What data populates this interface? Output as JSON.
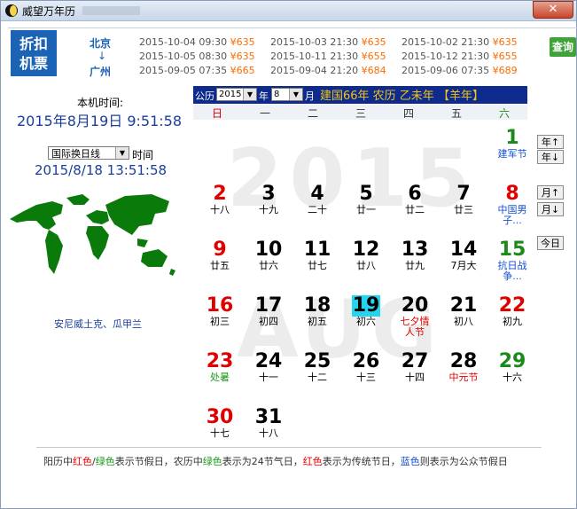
{
  "window": {
    "title": "威望万年历"
  },
  "banner": {
    "ticket_button": [
      "折扣",
      "机票"
    ],
    "from_city": "北京",
    "arrow": "↓",
    "to_city": "广州",
    "query_button": "查询",
    "fares": [
      [
        "2015-10-04 09:30",
        "¥635"
      ],
      [
        "2015-10-03 21:30",
        "¥635"
      ],
      [
        "2015-10-02 21:30",
        "¥635"
      ],
      [
        "2015-10-05 08:30",
        "¥635"
      ],
      [
        "2015-10-11 21:30",
        "¥655"
      ],
      [
        "2015-10-12 21:30",
        "¥655"
      ],
      [
        "2015-09-05 07:35",
        "¥665"
      ],
      [
        "2015-09-04 21:20",
        "¥684"
      ],
      [
        "2015-09-06 07:35",
        "¥689"
      ]
    ]
  },
  "left": {
    "local_time_label": "本机时间:",
    "local_time": "2015年8月19日  9:51:58",
    "tz_select": "国际换日线",
    "tz_time_label": "时间",
    "tz_datetime": "2015/8/18 13:51:58",
    "location": "安尼威土克、瓜甲兰"
  },
  "calendar": {
    "gregorian_label": "公历",
    "year_value": "2015",
    "year_label": "年",
    "month_value": "8",
    "month_label": "月",
    "lunar_header": "建国66年  农历  乙未年  【羊年】",
    "weekdays": [
      "日",
      "一",
      "二",
      "三",
      "四",
      "五",
      "六"
    ],
    "watermark_year": "2015",
    "watermark_month": "AUG",
    "days": [
      {
        "n": "1",
        "sub": "建军节",
        "nc": "#1a8a1a",
        "sc": "#1450d0"
      },
      {
        "n": "2",
        "sub": "十八",
        "nc": "#e00000",
        "sc": "#000"
      },
      {
        "n": "3",
        "sub": "十九",
        "nc": "#000",
        "sc": "#000"
      },
      {
        "n": "4",
        "sub": "二十",
        "nc": "#000",
        "sc": "#000"
      },
      {
        "n": "5",
        "sub": "廿一",
        "nc": "#000",
        "sc": "#000"
      },
      {
        "n": "6",
        "sub": "廿二",
        "nc": "#000",
        "sc": "#000"
      },
      {
        "n": "7",
        "sub": "廿三",
        "nc": "#000",
        "sc": "#000"
      },
      {
        "n": "8",
        "sub": "中国男子...",
        "nc": "#e00000",
        "sc": "#1450d0"
      },
      {
        "n": "9",
        "sub": "廿五",
        "nc": "#e00000",
        "sc": "#000"
      },
      {
        "n": "10",
        "sub": "廿六",
        "nc": "#000",
        "sc": "#000"
      },
      {
        "n": "11",
        "sub": "廿七",
        "nc": "#000",
        "sc": "#000"
      },
      {
        "n": "12",
        "sub": "廿八",
        "nc": "#000",
        "sc": "#000"
      },
      {
        "n": "13",
        "sub": "廿九",
        "nc": "#000",
        "sc": "#000"
      },
      {
        "n": "14",
        "sub": "7月大",
        "nc": "#000",
        "sc": "#000"
      },
      {
        "n": "15",
        "sub": "抗日战争...",
        "nc": "#1a8a1a",
        "sc": "#1450d0"
      },
      {
        "n": "16",
        "sub": "初三",
        "nc": "#e00000",
        "sc": "#000"
      },
      {
        "n": "17",
        "sub": "初四",
        "nc": "#000",
        "sc": "#000"
      },
      {
        "n": "18",
        "sub": "初五",
        "nc": "#000",
        "sc": "#000"
      },
      {
        "n": "19",
        "sub": "初六",
        "nc": "#000",
        "sc": "#000"
      },
      {
        "n": "20",
        "sub": "七夕情人节",
        "nc": "#000",
        "sc": "#e00000"
      },
      {
        "n": "21",
        "sub": "初八",
        "nc": "#000",
        "sc": "#000"
      },
      {
        "n": "22",
        "sub": "初九",
        "nc": "#e00000",
        "sc": "#000"
      },
      {
        "n": "23",
        "sub": "处暑",
        "nc": "#e00000",
        "sc": "#1a9a1a"
      },
      {
        "n": "24",
        "sub": "十一",
        "nc": "#000",
        "sc": "#000"
      },
      {
        "n": "25",
        "sub": "十二",
        "nc": "#000",
        "sc": "#000"
      },
      {
        "n": "26",
        "sub": "十三",
        "nc": "#000",
        "sc": "#000"
      },
      {
        "n": "27",
        "sub": "十四",
        "nc": "#000",
        "sc": "#000"
      },
      {
        "n": "28",
        "sub": "中元节",
        "nc": "#000",
        "sc": "#e00000"
      },
      {
        "n": "29",
        "sub": "十六",
        "nc": "#1a8a1a",
        "sc": "#000"
      },
      {
        "n": "30",
        "sub": "十七",
        "nc": "#e00000",
        "sc": "#000"
      },
      {
        "n": "31",
        "sub": "十八",
        "nc": "#000",
        "sc": "#000"
      }
    ],
    "today": "19",
    "first_weekday": 6
  },
  "nav": {
    "year_up": "年↑",
    "year_down": "年↓",
    "month_up": "月↑",
    "month_down": "月↓",
    "today": "今日"
  },
  "footer": {
    "parts": [
      {
        "t": "阳历中",
        "c": ""
      },
      {
        "t": "红色",
        "c": "r"
      },
      {
        "t": "/",
        "c": ""
      },
      {
        "t": "绿色",
        "c": "g"
      },
      {
        "t": "表示节假日，农历中",
        "c": ""
      },
      {
        "t": "绿色",
        "c": "g"
      },
      {
        "t": "表示为24节气日，",
        "c": ""
      },
      {
        "t": "红色",
        "c": "r"
      },
      {
        "t": "表示为传统节日，",
        "c": ""
      },
      {
        "t": "蓝色",
        "c": "b"
      },
      {
        "t": "则表示为公众节假日",
        "c": ""
      }
    ]
  }
}
